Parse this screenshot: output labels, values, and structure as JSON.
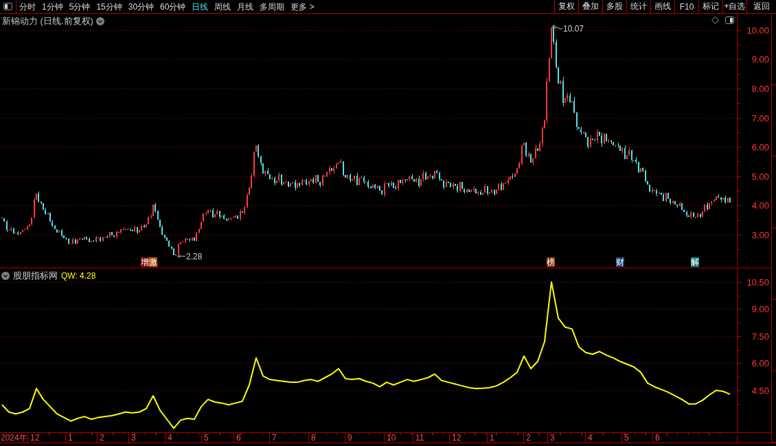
{
  "toolbar": {
    "periods": [
      {
        "label": "分时",
        "selected": false
      },
      {
        "label": "1分钟",
        "selected": false
      },
      {
        "label": "5分钟",
        "selected": false
      },
      {
        "label": "15分钟",
        "selected": false
      },
      {
        "label": "30分钟",
        "selected": false
      },
      {
        "label": "60分钟",
        "selected": false
      },
      {
        "label": "日线",
        "selected": true
      },
      {
        "label": "周线",
        "selected": false
      },
      {
        "label": "月线",
        "selected": false
      },
      {
        "label": "多周期",
        "selected": false
      },
      {
        "label": "更多 >",
        "selected": false
      }
    ],
    "tools": [
      "复权",
      "叠加",
      "多股",
      "统计",
      "画线",
      "F10",
      "标记",
      "+自选",
      "返回"
    ]
  },
  "price_panel": {
    "title": "新锦动力 (日线.前复权)",
    "axis_labels": [
      "10.00",
      "9.00",
      "8.00",
      "7.00",
      "6.00",
      "5.00",
      "4.00",
      "3.00"
    ],
    "high_label": "10.07",
    "low_label": "2.28",
    "events": [
      {
        "label": "增",
        "color": "#8a0f0f"
      },
      {
        "label": "激",
        "color": "#b5500f"
      },
      {
        "label": "榜",
        "color": "#8b3510"
      },
      {
        "label": "财",
        "color": "#1a3f7a"
      },
      {
        "label": "解",
        "color": "#0f8080"
      }
    ]
  },
  "indicator_panel": {
    "title": "股朋指标网",
    "reading": "QW: 4.28",
    "chart_data": {
      "type": "line",
      "ylim": [
        2.18,
        11.26
      ],
      "yticks": [
        {
          "value": 10.5,
          "label": "10.50"
        },
        {
          "value": 9,
          "label": "9.00"
        },
        {
          "value": 7.5,
          "label": "7.50"
        },
        {
          "value": 6,
          "label": "6.00"
        },
        {
          "value": 4.5,
          "label": "4.50"
        }
      ],
      "grid": true,
      "series": [
        {
          "color": "#ffff00",
          "values": [
            3.7,
            3.3,
            3.2,
            3.3,
            3.5,
            4.6,
            4.0,
            3.6,
            3.2,
            3.0,
            2.8,
            2.95,
            3.05,
            2.9,
            3.0,
            3.05,
            3.1,
            3.2,
            3.3,
            3.25,
            3.3,
            3.5,
            4.2,
            3.4,
            2.9,
            2.4,
            2.85,
            2.95,
            2.9,
            3.6,
            4.0,
            3.85,
            3.8,
            3.7,
            3.8,
            3.9,
            4.8,
            6.3,
            5.3,
            5.1,
            5.05,
            5.0,
            4.95,
            4.95,
            5.05,
            5.1,
            5.0,
            5.2,
            5.4,
            5.7,
            5.15,
            5.1,
            5.15,
            5.0,
            4.9,
            4.7,
            4.95,
            4.8,
            4.95,
            5.1,
            5.0,
            5.1,
            5.2,
            5.4,
            5.05,
            4.95,
            4.85,
            4.75,
            4.65,
            4.6,
            4.62,
            4.65,
            4.75,
            4.95,
            5.2,
            5.5,
            6.4,
            5.7,
            6.1,
            7.2,
            10.5,
            8.5,
            8.0,
            7.9,
            6.9,
            6.6,
            6.5,
            6.65,
            6.45,
            6.3,
            6.1,
            5.95,
            5.8,
            5.5,
            4.9,
            4.7,
            4.55,
            4.4,
            4.2,
            4.0,
            3.75,
            3.75,
            3.95,
            4.25,
            4.5,
            4.45,
            4.28
          ]
        }
      ]
    }
  },
  "time_axis": {
    "year": "2024年",
    "months": [
      "12",
      "1",
      "2",
      "3",
      "4",
      "5",
      "6",
      "7",
      "8",
      "9",
      "10",
      "11",
      "12",
      "1",
      "2",
      "3",
      "4",
      "5",
      "6"
    ]
  }
}
